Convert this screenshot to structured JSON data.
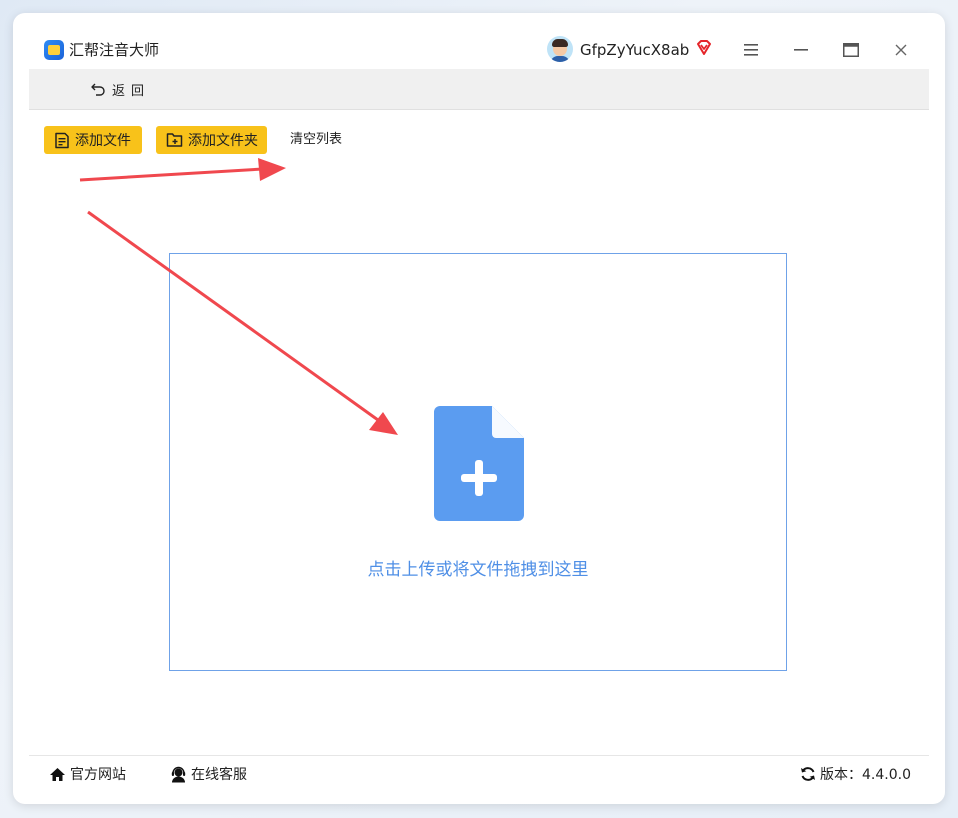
{
  "window": {
    "app_title": "汇帮注音大师",
    "username": "GfpZyYucX8ab"
  },
  "toolbar": {
    "back_label": "返回"
  },
  "actions": {
    "add_file_label": "添加文件",
    "add_folder_label": "添加文件夹",
    "clear_list_label": "清空列表"
  },
  "dropzone": {
    "hint": "点击上传或将文件拖拽到这里"
  },
  "footer": {
    "website_label": "官方网站",
    "support_label": "在线客服",
    "version_label": "版本：4.4.0.0"
  },
  "colors": {
    "accent_yellow": "#f8c21a",
    "dropzone_blue": "#6fa2e8",
    "icon_blue": "#5b9cf0",
    "arrow_red": "#f0484e",
    "vip_red": "#e5252a"
  },
  "icons": {
    "logo": "app-logo-icon",
    "vip": "vip-diamond-icon",
    "menu": "menu-icon",
    "minimize": "minimize-icon",
    "maximize": "maximize-icon",
    "close": "close-icon",
    "back": "back-arrow-icon",
    "file": "file-list-icon",
    "folder": "folder-add-icon",
    "upload": "file-add-icon",
    "home": "home-icon",
    "support": "support-agent-icon",
    "update": "refresh-icon"
  }
}
